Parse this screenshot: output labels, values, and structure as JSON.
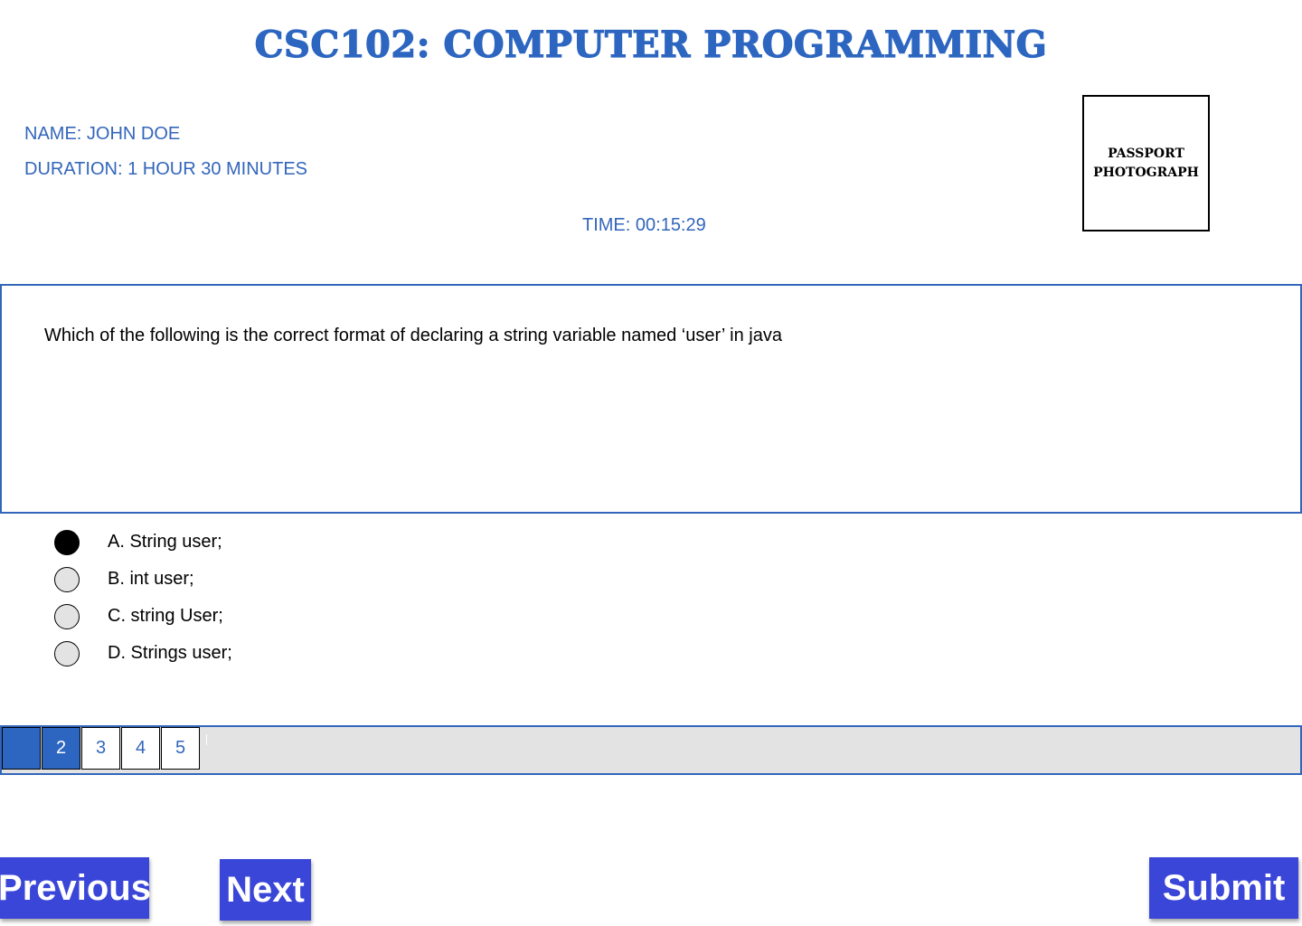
{
  "header": {
    "title": "CSC102: COMPUTER PROGRAMMING"
  },
  "candidate": {
    "name": "NAME: JOHN DOE",
    "duration": "DURATION: 1 HOUR 30 MINUTES",
    "photo_placeholder": "PASSPORT PHOTOGRAPH"
  },
  "timer": {
    "label": "TIME: 00:15:29"
  },
  "question": {
    "text": "Which of the following is the correct format of declaring a string variable named ‘user’ in java",
    "options": [
      {
        "label": "A. String user;",
        "selected": true
      },
      {
        "label": "B. int user;",
        "selected": false
      },
      {
        "label": "C. string User;",
        "selected": false
      },
      {
        "label": "D. Strings user;",
        "selected": false
      }
    ]
  },
  "pagination": {
    "pages": [
      "",
      "2",
      "3",
      "4",
      "5"
    ],
    "current": "2"
  },
  "actions": {
    "previous_label": "Previous",
    "next_label": "Next",
    "submit_label": "Submit"
  },
  "colors": {
    "accent": "#2d66c0",
    "button": "#3a46d8",
    "text_blue": "#3366bb",
    "pager_bg": "#e3e3e3"
  }
}
